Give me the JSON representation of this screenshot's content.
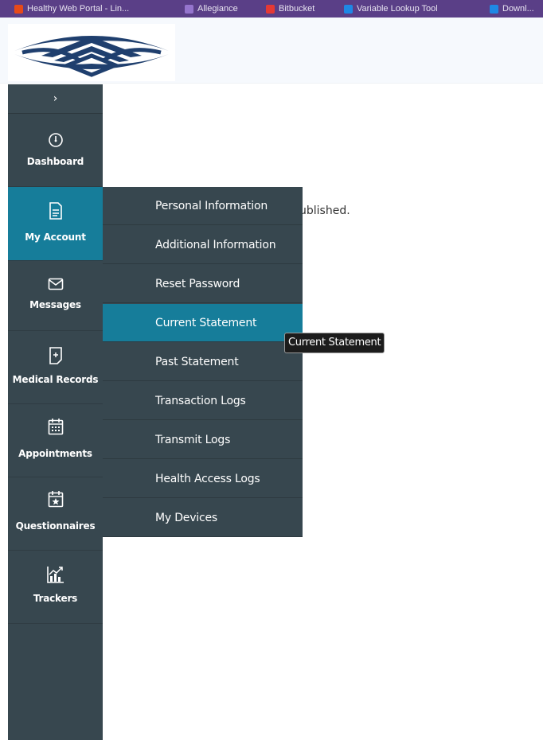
{
  "browser": {
    "bookmarks": [
      {
        "label": "Healthy Web Portal - Lin...",
        "color": "#e64a19"
      },
      {
        "label": "Allegiance",
        "color": "#9575cd"
      },
      {
        "label": "Bitbucket",
        "color": "#e53935"
      },
      {
        "label": "Variable Lookup Tool",
        "color": "#1e88e5"
      },
      {
        "label": "Downl...",
        "color": "#1e88e5"
      }
    ]
  },
  "colors": {
    "sidebar_bg": "#37474f",
    "active_bg": "#167d9a",
    "browser_bar": "#5a3f87",
    "logo_navy": "#1f3f6e"
  },
  "sidebar": {
    "toggle_icon": "chevron-right-icon",
    "items": [
      {
        "label": "Dashboard",
        "icon": "speedometer-icon"
      },
      {
        "label": "My Account",
        "icon": "document-icon",
        "active": true
      },
      {
        "label": "Messages",
        "icon": "envelope-icon"
      },
      {
        "label": "Medical Records",
        "icon": "medical-file-icon"
      },
      {
        "label": "Appointments",
        "icon": "calendar-icon"
      },
      {
        "label": "Questionnaires",
        "icon": "calendar-star-icon"
      },
      {
        "label": "Trackers",
        "icon": "chart-icon"
      }
    ]
  },
  "submenu": {
    "items": [
      {
        "label": "Personal Information"
      },
      {
        "label": "Additional Information"
      },
      {
        "label": "Reset Password"
      },
      {
        "label": "Current Statement",
        "active": true
      },
      {
        "label": "Past Statement"
      },
      {
        "label": "Transaction Logs"
      },
      {
        "label": "Transmit Logs"
      },
      {
        "label": "Health Access Logs"
      },
      {
        "label": "My Devices"
      }
    ]
  },
  "main": {
    "partial_text": "ublished."
  },
  "tooltip": {
    "text": "Current Statement"
  }
}
